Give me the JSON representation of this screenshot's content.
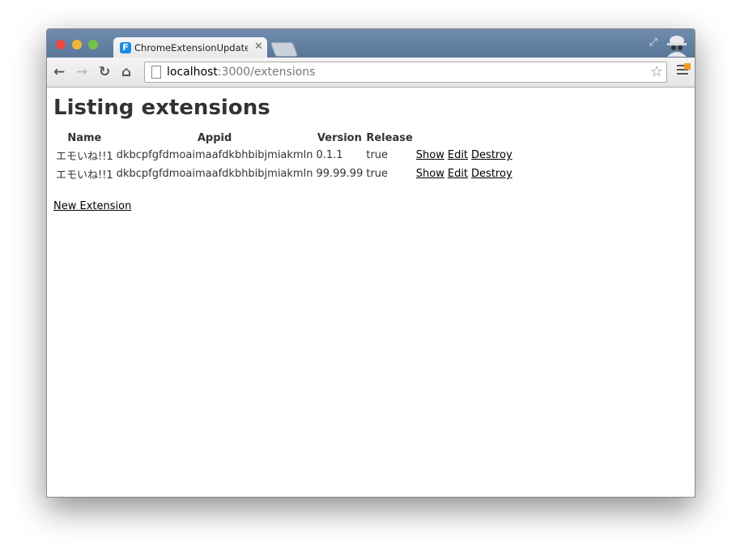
{
  "browser": {
    "tab_title": "ChromeExtensionUpdateC",
    "tab_favicon_letter": "F",
    "url_host": "localhost",
    "url_rest": ":3000/extensions"
  },
  "page": {
    "title": "Listing extensions",
    "columns": [
      "Name",
      "Appid",
      "Version",
      "Release"
    ],
    "rows": [
      {
        "name": "エモいね!!1",
        "appid": "dkbcpfgfdmoaimaafdkbhbibjmiakmln",
        "version": "0.1.1",
        "release": "true",
        "show": "Show",
        "edit": "Edit",
        "destroy": "Destroy"
      },
      {
        "name": "エモいね!!1",
        "appid": "dkbcpfgfdmoaimaafdkbhbibjmiakmln",
        "version": "99.99.99",
        "release": "true",
        "show": "Show",
        "edit": "Edit",
        "destroy": "Destroy"
      }
    ],
    "new_link": "New Extension"
  },
  "colors": {
    "titlebar": "#5a7799",
    "favicon": "#1c8ce6",
    "badge": "#f39a1d"
  }
}
